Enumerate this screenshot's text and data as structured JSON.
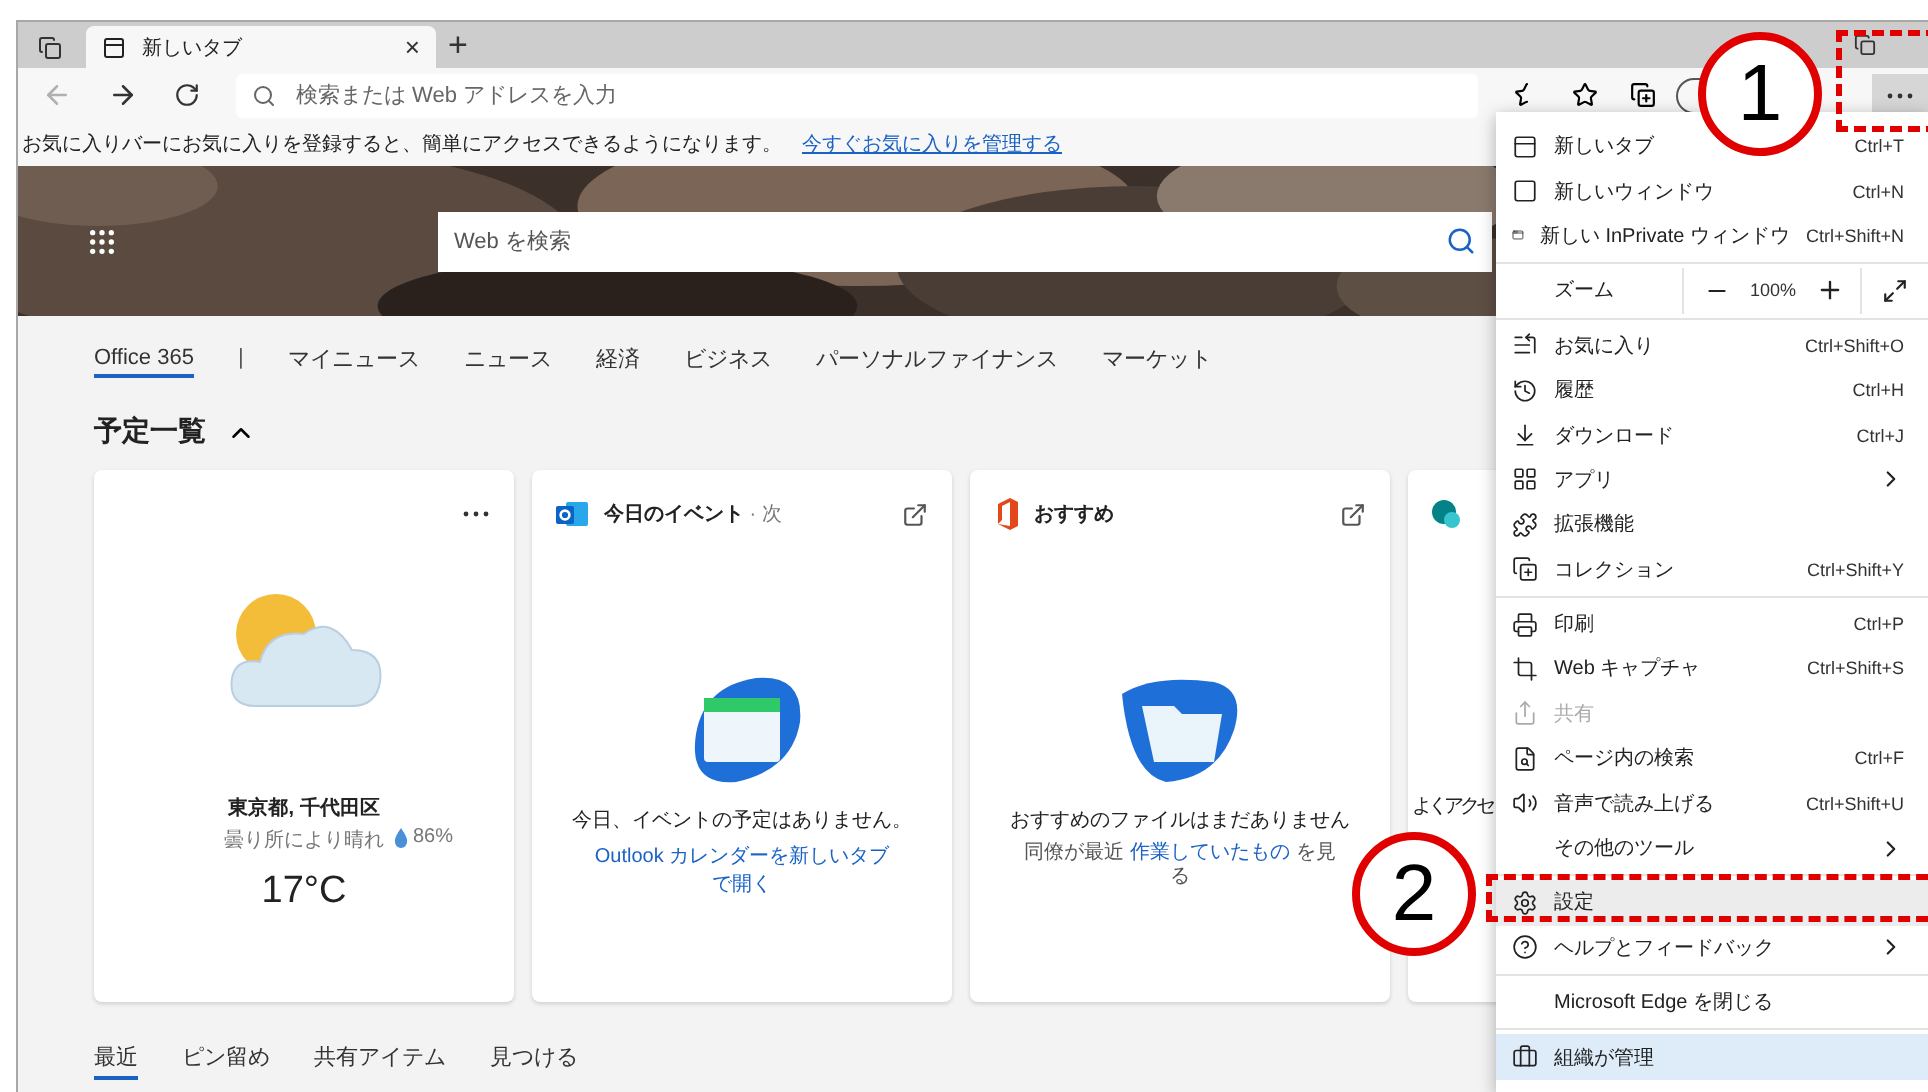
{
  "tabs": [
    {
      "label": "新しいタブ",
      "selected": true,
      "close": "×"
    }
  ],
  "new_tab": "+",
  "address_bar": {
    "placeholder": "検索または Web アドレスを入力",
    "back_disabled": true
  },
  "favorites_bar": {
    "message": "お気に入りバーにお気に入りを登録すると、簡単にアクセスできるようになります。",
    "link": "今すぐお気に入りを管理する"
  },
  "hero": {
    "search_placeholder": "Web を検索"
  },
  "nav": [
    {
      "kind": "tab",
      "label": "Office 365",
      "selected": true
    },
    {
      "kind": "separator",
      "label": "|"
    },
    {
      "kind": "tab",
      "label": "マイニュース",
      "selected": false
    },
    {
      "kind": "tab",
      "label": "ニュース",
      "selected": false
    },
    {
      "kind": "tab",
      "label": "経済",
      "selected": false
    },
    {
      "kind": "tab",
      "label": "ビジネス",
      "selected": false
    },
    {
      "kind": "tab",
      "label": "パーソナルファイナンス",
      "selected": false
    },
    {
      "kind": "tab",
      "label": "マーケット",
      "selected": false
    }
  ],
  "section": {
    "title": "予定一覧",
    "expanded": true
  },
  "cards": [
    {
      "kind": "weather",
      "location": "東京都, 千代田区",
      "condition": "曇り所により晴れ",
      "humidity": "86%",
      "humidity_icon": true,
      "temperature": "17°C"
    },
    {
      "kind": "events",
      "title": "今日のイベント",
      "subtitle": "· 次",
      "message": "今日、イベントの予定はありません。",
      "link": "Outlook カレンダーを新しいタブで開く"
    },
    {
      "kind": "recommended",
      "title": "おすすめ",
      "message": "おすすめのファイルはまだありません",
      "before": "同僚が最近",
      "link": "作業していたもの",
      "after": "を見る"
    },
    {
      "kind": "frequent",
      "message": "よくアクセ"
    }
  ],
  "bottom_tabs": [
    {
      "label": "最近",
      "selected": true
    },
    {
      "label": "ピン留め",
      "selected": false
    },
    {
      "label": "共有アイテム",
      "selected": false
    },
    {
      "label": "見つける",
      "selected": false
    }
  ],
  "menu": {
    "sections": [
      {
        "items": [
          {
            "kind": "item",
            "label": "新しいタブ",
            "shortcut": "Ctrl+T"
          },
          {
            "kind": "item",
            "label": "新しいウィンドウ",
            "shortcut": "Ctrl+N"
          },
          {
            "kind": "item",
            "label": "新しい InPrivate ウィンドウ",
            "shortcut": "Ctrl+Shift+N"
          }
        ]
      },
      {
        "items": [
          {
            "kind": "zoom",
            "label": "ズーム",
            "value": "100%"
          }
        ]
      },
      {
        "items": [
          {
            "kind": "item",
            "label": "お気に入り",
            "shortcut": "Ctrl+Shift+O"
          },
          {
            "kind": "item",
            "label": "履歴",
            "shortcut": "Ctrl+H"
          },
          {
            "kind": "item",
            "label": "ダウンロード",
            "shortcut": "Ctrl+J"
          },
          {
            "kind": "item",
            "label": "アプリ",
            "submenu": true
          },
          {
            "kind": "item",
            "label": "拡張機能"
          },
          {
            "kind": "item",
            "label": "コレクション",
            "shortcut": "Ctrl+Shift+Y"
          }
        ]
      },
      {
        "items": [
          {
            "kind": "item",
            "label": "印刷",
            "shortcut": "Ctrl+P"
          },
          {
            "kind": "item",
            "label": "Web キャプチャ",
            "shortcut": "Ctrl+Shift+S"
          },
          {
            "kind": "item",
            "label": "共有",
            "disabled": true
          },
          {
            "kind": "item",
            "label": "ページ内の検索",
            "shortcut": "Ctrl+F"
          },
          {
            "kind": "item",
            "label": "音声で読み上げる",
            "shortcut": "Ctrl+Shift+U"
          },
          {
            "kind": "item",
            "label": "その他のツール",
            "submenu": true
          }
        ]
      },
      {
        "items": [
          {
            "kind": "item",
            "label": "設定",
            "selected": true
          },
          {
            "kind": "item",
            "label": "ヘルプとフィードバック",
            "submenu": true
          }
        ]
      },
      {
        "items": [
          {
            "kind": "item",
            "label": "Microsoft Edge を閉じる"
          }
        ]
      },
      {
        "items": [
          {
            "kind": "footer",
            "label": "組織が管理"
          }
        ]
      }
    ]
  },
  "annotations": [
    {
      "number": "1"
    },
    {
      "number": "2"
    }
  ]
}
